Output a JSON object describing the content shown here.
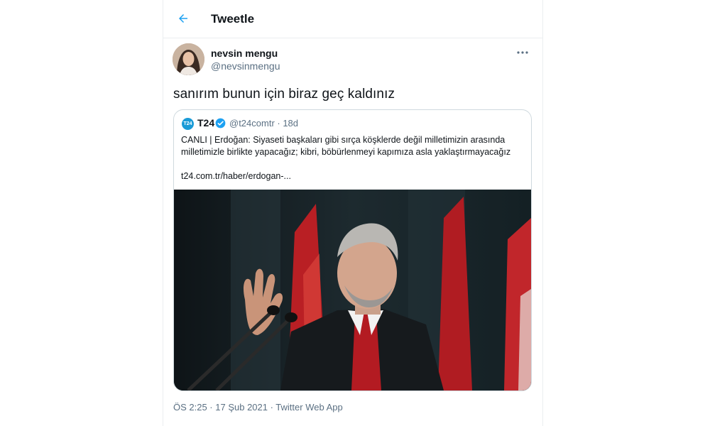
{
  "header": {
    "title": "Tweetle"
  },
  "tweet": {
    "display_name": "nevsin mengu",
    "handle": "@nevsinmengu",
    "text": "sanırım bunun için biraz geç kaldınız",
    "timestamp": "ÖS 2:25 · 17 Şub 2021 · Twitter Web App"
  },
  "quoted": {
    "avatar_text": "T24",
    "name": "T24",
    "handle_time": "@t24comtr · 18d",
    "text": "CANLI | Erdoğan: Siyaseti başkaları gibi sırça köşklerde değil milletimizin arasında milletimizle birlikte yapacağız; kibri, böbürlenmeyi kapımıza asla yaklaştırmayacağız",
    "link": "t24.com.tr/haber/erdogan-..."
  },
  "icons": {
    "back": "arrow-left-icon",
    "more": "more-horizontal-icon",
    "verified": "verified-badge-icon"
  },
  "colors": {
    "accent": "#1da1f2",
    "text_primary": "#0f1419",
    "text_secondary": "#5b7083",
    "border": "#cfd9de"
  }
}
